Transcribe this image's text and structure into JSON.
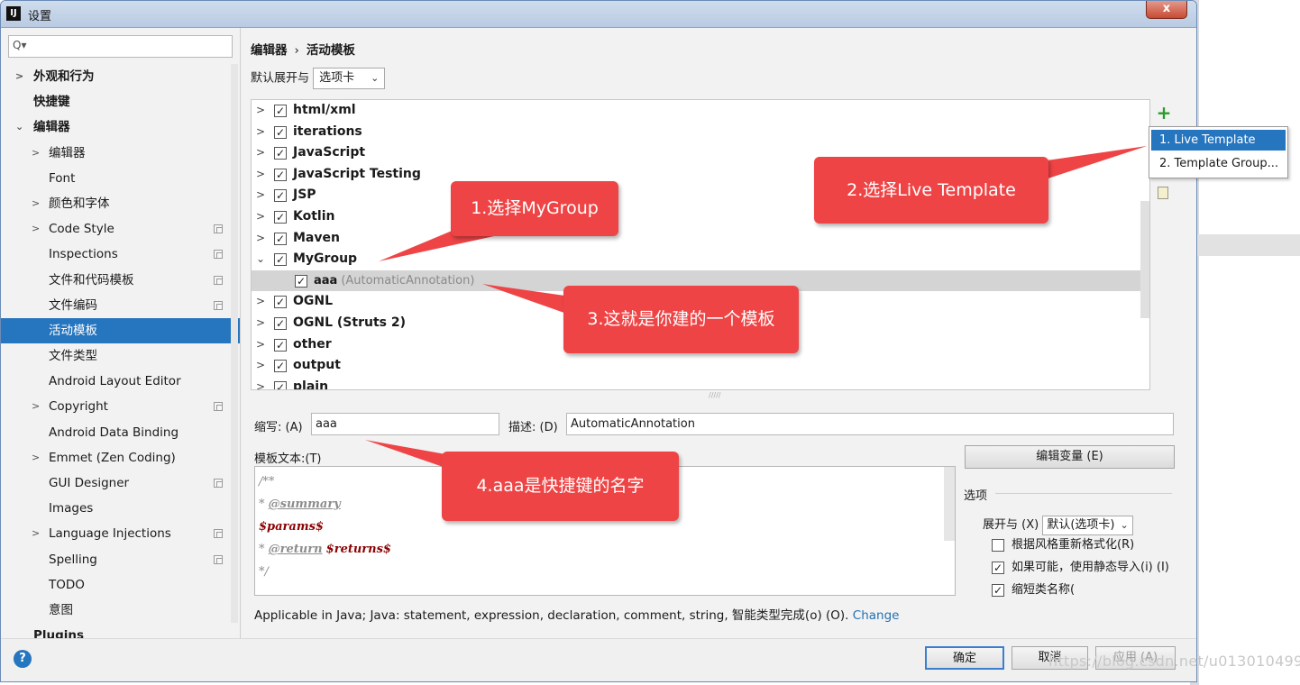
{
  "window": {
    "title": "设置",
    "app_icon": "IJ",
    "close_label": "x"
  },
  "sidebar": {
    "search_placeholder": "Q▾",
    "items": [
      {
        "label": "外观和行为",
        "arrow": ">",
        "bold": true
      },
      {
        "label": "快捷键",
        "bold": true
      },
      {
        "label": "编辑器",
        "arrow": "⌄",
        "bold": true
      },
      {
        "label": "编辑器",
        "arrow": ">"
      },
      {
        "label": "Font"
      },
      {
        "label": "颜色和字体",
        "arrow": ">"
      },
      {
        "label": "Code Style",
        "arrow": ">",
        "copy": true
      },
      {
        "label": "Inspections",
        "copy": true
      },
      {
        "label": "文件和代码模板",
        "copy": true
      },
      {
        "label": "文件编码",
        "copy": true
      },
      {
        "label": "活动模板",
        "selected": true
      },
      {
        "label": "文件类型"
      },
      {
        "label": "Android Layout Editor"
      },
      {
        "label": "Copyright",
        "arrow": ">",
        "copy": true
      },
      {
        "label": "Android Data Binding"
      },
      {
        "label": "Emmet (Zen Coding)",
        "arrow": ">"
      },
      {
        "label": "GUI Designer",
        "copy": true
      },
      {
        "label": "Images"
      },
      {
        "label": "Language Injections",
        "arrow": ">",
        "copy": true
      },
      {
        "label": "Spelling",
        "copy": true
      },
      {
        "label": "TODO"
      },
      {
        "label": "意图"
      },
      {
        "label": "Plugins",
        "bold": true
      }
    ]
  },
  "breadcrumb": {
    "parent": "编辑器",
    "separator": "›",
    "current": "活动模板"
  },
  "expand_with": {
    "label": "默认展开与",
    "value": "选项卡",
    "chevron": "⌄"
  },
  "templates": [
    {
      "name": "html/xml"
    },
    {
      "name": "iterations"
    },
    {
      "name": "JavaScript"
    },
    {
      "name": "JavaScript Testing"
    },
    {
      "name": "JSP"
    },
    {
      "name": "Kotlin"
    },
    {
      "name": "Maven"
    },
    {
      "name": "MyGroup",
      "expanded": true
    },
    {
      "name": "aaa",
      "desc": "(AutomaticAnnotation)",
      "child": true
    },
    {
      "name": "OGNL"
    },
    {
      "name": "OGNL (Struts 2)"
    },
    {
      "name": "other"
    },
    {
      "name": "output"
    },
    {
      "name": "plain"
    }
  ],
  "add_menu": {
    "plus": "+",
    "items": [
      "1. Live Template",
      "2. Template Group..."
    ]
  },
  "editor": {
    "abbr_label": "缩写: (A)",
    "abbr_value": "aaa",
    "desc_label": "描述: (D)",
    "desc_value": "AutomaticAnnotation",
    "text_label": "模板文本:(T)",
    "code": {
      "l1": "/**",
      "l2_prefix": " * ",
      "l2_tag": "@summary",
      "l3": "$params$",
      "l4_prefix": " * ",
      "l4_tag": "@return",
      "l4_var": "$returns$",
      "l5": "*/"
    },
    "edit_vars": "编辑变量 (E)",
    "options_label": "选项",
    "expand2_label": "展开与 (X)",
    "expand2_value": "默认(选项卡)",
    "opt_reformat": "根据风格重新格式化(R)",
    "opt_static": "如果可能，使用静态导入(i) (I)",
    "opt_shorten": "缩短类名称(",
    "applicable_text": "Applicable in Java; Java: statement, expression, declaration, comment, string, 智能类型完成(o) (O).",
    "applicable_link": "Change"
  },
  "footer": {
    "help": "?",
    "ok": "确定",
    "cancel": "取消",
    "apply": "应用 (A)"
  },
  "watermark": "https://blog.csdn.net/u013010499",
  "callouts": {
    "c1": "1.选择MyGroup",
    "c2": "2.选择Live Template",
    "c3": "3.这就是你建的一个模板",
    "c4": "4.aaa是快捷键的名字"
  },
  "colors": {
    "selection": "#2675bf",
    "callout": "#ef4445",
    "add": "#2d9a2d",
    "link": "#2470b3"
  }
}
